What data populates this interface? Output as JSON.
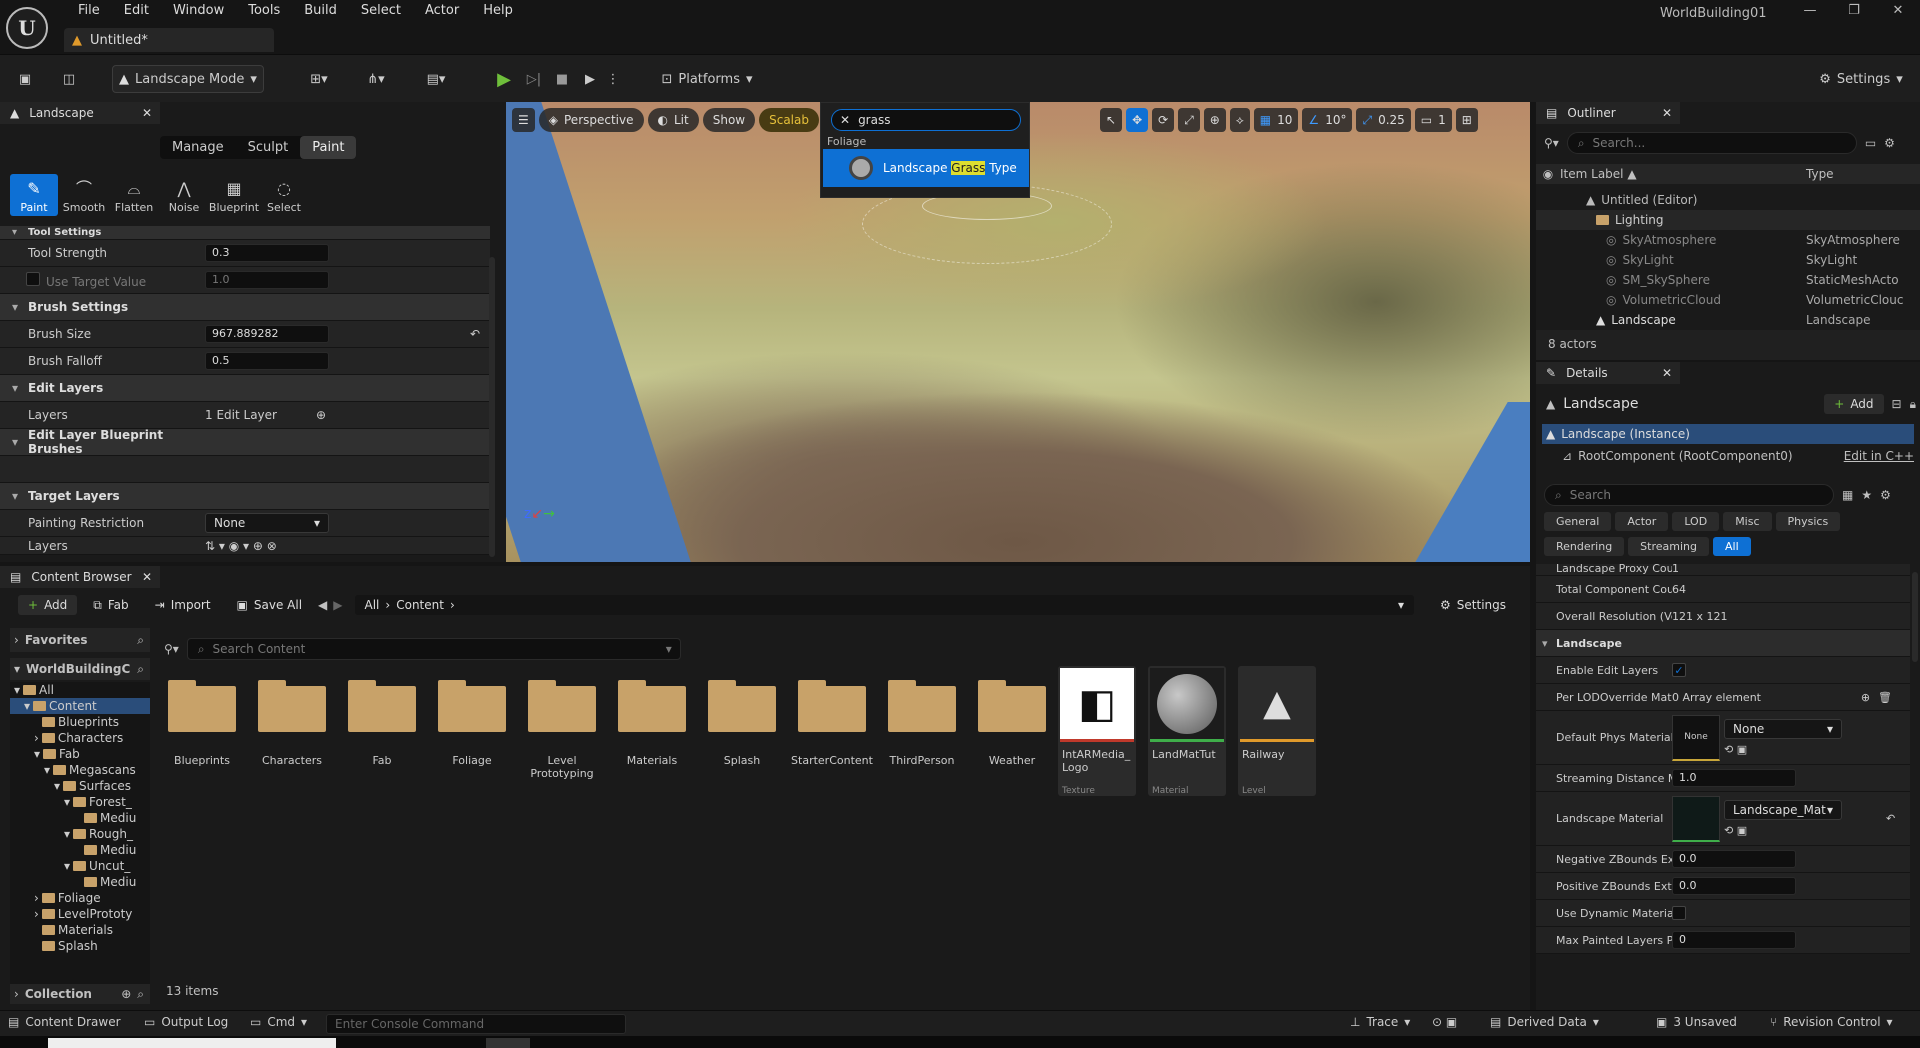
{
  "window": {
    "title": "WorldBuilding01",
    "doc_tab": "Untitled*"
  },
  "menu": [
    "File",
    "Edit",
    "Window",
    "Tools",
    "Build",
    "Select",
    "Actor",
    "Help"
  ],
  "toolbar": {
    "mode": "Landscape Mode",
    "platforms": "Platforms",
    "settings": "Settings"
  },
  "landscape_panel": {
    "title": "Landscape",
    "tabs": [
      "Manage",
      "Sculpt",
      "Paint"
    ],
    "tools": [
      "Paint",
      "Smooth",
      "Flatten",
      "Noise",
      "Blueprint",
      "Select"
    ],
    "rows": [
      {
        "label": "Tool Settings",
        "type": "header"
      },
      {
        "label": "Tool Strength",
        "value": "0.3"
      },
      {
        "label": "Use Target Value",
        "value": "1.0"
      },
      {
        "label": "Brush Settings",
        "type": "header"
      },
      {
        "label": "Brush Size",
        "value": "967.889282"
      },
      {
        "label": "Brush Falloff",
        "value": "0.5"
      },
      {
        "label": "Edit Layers",
        "type": "header"
      },
      {
        "label": "Layers",
        "value": "1 Edit Layer"
      },
      {
        "label": "Edit Layer Blueprint Brushes",
        "type": "header"
      },
      {
        "label": "",
        "value": ""
      },
      {
        "label": "Target Layers",
        "type": "header"
      },
      {
        "label": "Painting Restriction",
        "value": "None"
      },
      {
        "label": "Layers",
        "value": ""
      }
    ]
  },
  "viewport": {
    "perspective": "Perspective",
    "lit": "Lit",
    "show": "Show",
    "scalability": "Scalab",
    "grid": "10",
    "angle": "10°",
    "scale": "0.25",
    "camera": "1"
  },
  "search_popup": {
    "query": "grass",
    "category": "Foliage",
    "result_pre": "Landscape ",
    "result_hl": "Grass",
    "result_post": " Type"
  },
  "outliner": {
    "title": "Outliner",
    "search_placeholder": "Search...",
    "col_label": "Item Label ▲",
    "col_type": "Type",
    "items": [
      {
        "label": "Untitled (Editor)",
        "type": ""
      },
      {
        "label": "Lighting",
        "type": ""
      },
      {
        "label": "SkyAtmosphere",
        "type": "SkyAtmosphere"
      },
      {
        "label": "SkyLight",
        "type": "SkyLight"
      },
      {
        "label": "SM_SkySphere",
        "type": "StaticMeshActo"
      },
      {
        "label": "VolumetricCloud",
        "type": "VolumetricClouc"
      },
      {
        "label": "Landscape",
        "type": "Landscape"
      }
    ],
    "count": "8 actors"
  },
  "details": {
    "title": "Details",
    "object": "Landscape",
    "add": "Add",
    "instance": "Landscape (Instance)",
    "root": "RootComponent (RootComponent0)",
    "edit_cpp": "Edit in C++",
    "search_placeholder": "Search",
    "filters": [
      "General",
      "Actor",
      "LOD",
      "Misc",
      "Physics",
      "Rendering",
      "Streaming",
      "All"
    ],
    "rows": [
      {
        "label": "Landscape Proxy Count",
        "value": "1"
      },
      {
        "label": "Total Component Count",
        "value": "64"
      },
      {
        "label": "Overall Resolution (Verts)",
        "value": "121 x 121"
      },
      {
        "label": "Landscape",
        "type": "header"
      },
      {
        "label": "Enable Edit Layers",
        "value": "✓"
      },
      {
        "label": "Per LODOverride Mate...",
        "value": "0 Array element"
      },
      {
        "label": "Default Phys Material",
        "value": "None"
      },
      {
        "label": "Streaming Distance M...",
        "value": "1.0"
      },
      {
        "label": "Landscape Material",
        "value": "Landscape_Mat"
      },
      {
        "label": "Negative ZBounds Ext...",
        "value": "0.0"
      },
      {
        "label": "Positive ZBounds Exte...",
        "value": "0.0"
      },
      {
        "label": "Use Dynamic Material...",
        "value": ""
      },
      {
        "label": "Max Painted Layers P...",
        "value": "0"
      }
    ],
    "phys_thumb": "None"
  },
  "content_browser": {
    "title": "Content Browser",
    "add": "Add",
    "fab": "Fab",
    "import": "Import",
    "save_all": "Save All",
    "path": [
      "All",
      "Content"
    ],
    "settings": "Settings",
    "favorites": "Favorites",
    "root": "WorldBuildingC",
    "collections": "Collection",
    "search_placeholder": "Search Content",
    "tree": [
      "All",
      "Content",
      "Blueprints",
      "Characters",
      "Fab",
      "Megascans",
      "Surfaces",
      "Forest_",
      "Mediu",
      "Rough_",
      "Mediu",
      "Uncut_",
      "Mediu",
      "Foliage",
      "LevelPrototy",
      "Materials",
      "Splash"
    ],
    "folders": [
      "Blueprints",
      "Characters",
      "Fab",
      "Foliage",
      "Level Prototyping",
      "Materials",
      "Splash",
      "StarterContent",
      "ThirdPerson",
      "Weather"
    ],
    "assets": [
      {
        "name": "IntARMedia_ Logo",
        "type": "Texture",
        "color": "#c0392b"
      },
      {
        "name": "LandMatTut",
        "type": "Material",
        "color": "#3fae4a"
      },
      {
        "name": "Railway",
        "type": "Level",
        "color": "#e09a2b"
      }
    ],
    "count": "13 items"
  },
  "statusbar": {
    "content_drawer": "Content Drawer",
    "output_log": "Output Log",
    "cmd": "Cmd",
    "console_placeholder": "Enter Console Command",
    "trace": "Trace",
    "derived": "Derived Data",
    "unsaved": "3 Unsaved",
    "revision": "Revision Control"
  }
}
